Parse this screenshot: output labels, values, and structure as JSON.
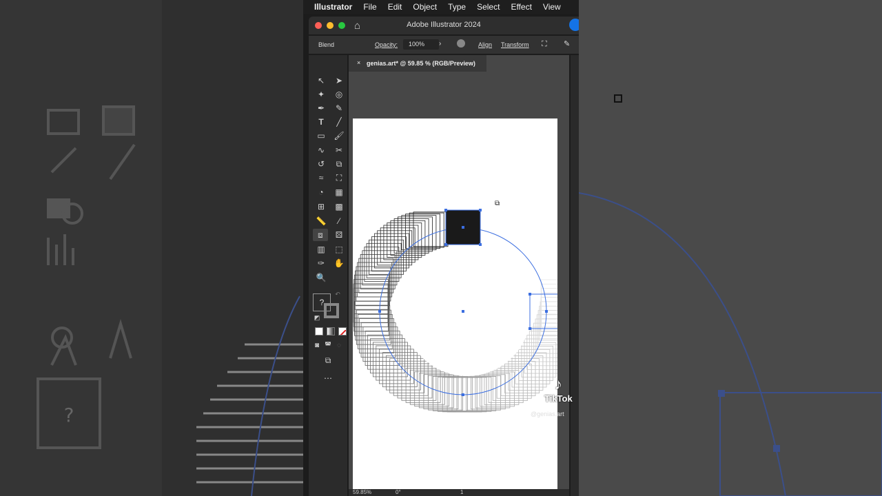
{
  "menubar": {
    "app": "Illustrator",
    "items": [
      "File",
      "Edit",
      "Object",
      "Type",
      "Select",
      "Effect",
      "View"
    ]
  },
  "window": {
    "title": "Adobe Illustrator 2024"
  },
  "control_bar": {
    "mode": "Blend",
    "opacity_label": "Opacity:",
    "opacity_value": "100%",
    "align": "Align",
    "transform": "Transform"
  },
  "document": {
    "tab_title": "genias.art* @ 59.85 % (RGB/Preview)",
    "zoom": "59.85%",
    "rotation": "0°",
    "artboard_number": "1"
  },
  "toolbar": {
    "fill_unknown": "?"
  },
  "watermark": {
    "brand": "TikTok",
    "handle": "@genias.art"
  },
  "colors": {
    "accent": "#1473e6",
    "selection": "#3b6ee0",
    "close": "#ff5f57",
    "minimize": "#febc2e",
    "maximize": "#28c840"
  }
}
